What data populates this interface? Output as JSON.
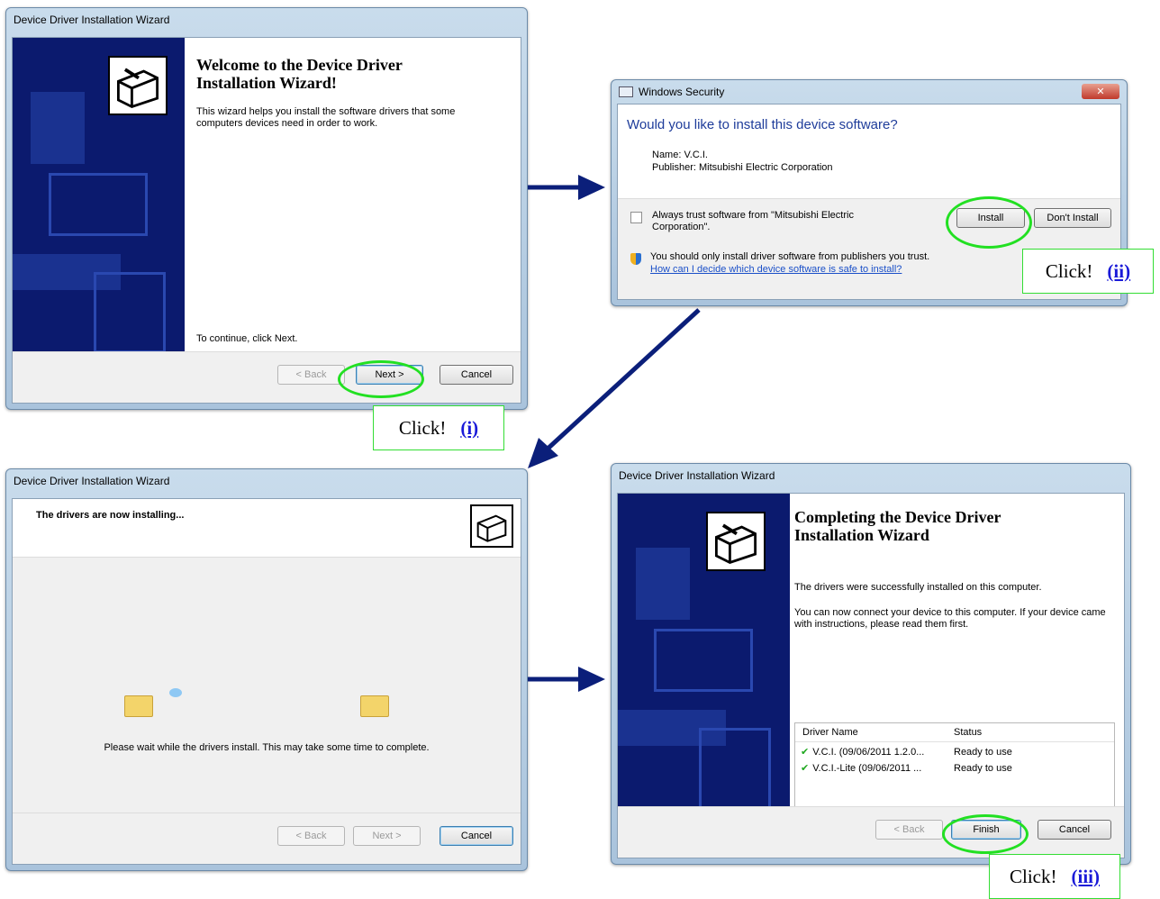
{
  "welcome": {
    "title": "Device Driver Installation Wizard",
    "heading": "Welcome to the Device Driver Installation Wizard!",
    "body": "This wizard helps you install the software drivers that some computers devices need in order to work.",
    "continue": "To continue, click Next.",
    "back": "< Back",
    "next": "Next >",
    "cancel": "Cancel"
  },
  "security": {
    "title": "Windows Security",
    "question": "Would you like to install this device software?",
    "name": "Name: V.C.I.",
    "publisher": "Publisher: Mitsubishi Electric Corporation",
    "trust": "Always trust software from \"Mitsubishi Electric Corporation\".",
    "install": "Install",
    "dont_install": "Don't Install",
    "warning": "You should only install driver software from publishers you trust.",
    "link": "How can I decide which device software is safe to install?"
  },
  "installing": {
    "title": "Device Driver Installation Wizard",
    "heading": "The drivers are now installing...",
    "wait": "Please wait while the drivers install. This may take some time to complete.",
    "back": "< Back",
    "next": "Next >",
    "cancel": "Cancel"
  },
  "completing": {
    "title": "Device Driver Installation Wizard",
    "heading": "Completing the Device Driver Installation Wizard",
    "success": "The drivers were successfully installed on this computer.",
    "connect": "You can now connect your device to this computer. If your device came with instructions, please read them first.",
    "col_name": "Driver Name",
    "col_status": "Status",
    "rows": [
      {
        "name": "V.C.I. (09/06/2011 1.2.0...",
        "status": "Ready to use"
      },
      {
        "name": "V.C.I.-Lite (09/06/2011 ...",
        "status": "Ready to use"
      }
    ],
    "back": "< Back",
    "finish": "Finish",
    "cancel": "Cancel"
  },
  "callouts": {
    "click": "Click!",
    "step_i": "(i)",
    "step_ii": "(ii)",
    "step_iii": "(iii)"
  },
  "colors": {
    "highlight": "#22e022",
    "arrow": "#0b1f7a",
    "step": "#1a1ad8"
  }
}
